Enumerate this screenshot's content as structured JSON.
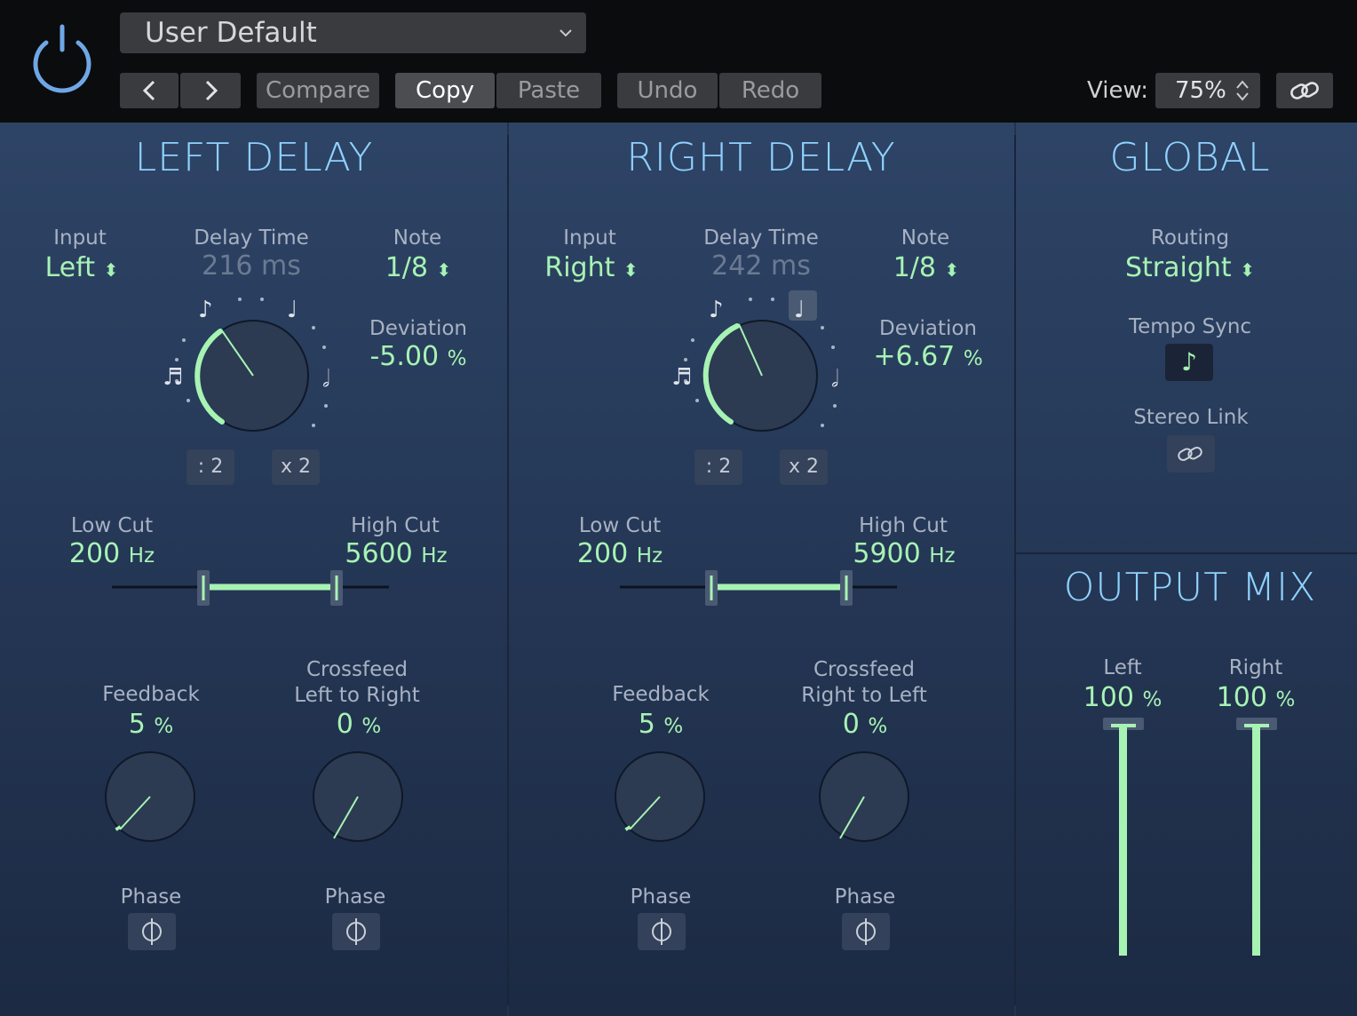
{
  "toolbar": {
    "preset": "User Default",
    "prev": "<",
    "next": ">",
    "compare": "Compare",
    "copy": "Copy",
    "paste": "Paste",
    "undo": "Undo",
    "redo": "Redo",
    "view_label": "View:",
    "view_value": "75%",
    "icons": [
      "power-icon",
      "chevron-down-icon",
      "link-icon",
      "stepper-icon"
    ]
  },
  "left_delay": {
    "title": "LEFT DELAY",
    "input_label": "Input",
    "input_value": "Left",
    "delay_time_label": "Delay Time",
    "delay_time_value": "216 ms",
    "note_label": "Note",
    "note_value": "1/8",
    "deviation_label": "Deviation",
    "deviation_value": "-5.00",
    "deviation_unit": "%",
    "half_label": ": 2",
    "double_label": "x 2",
    "low_cut_label": "Low Cut",
    "low_cut_value": "200",
    "high_cut_label": "High Cut",
    "high_cut_value": "5600",
    "hz": "Hz",
    "feedback_label": "Feedback",
    "feedback_value": "5",
    "crossfeed_label_1": "Crossfeed",
    "crossfeed_label_2": "Left to Right",
    "crossfeed_value": "0",
    "pct": "%",
    "phase_label": "Phase"
  },
  "right_delay": {
    "title": "RIGHT DELAY",
    "input_label": "Input",
    "input_value": "Right",
    "delay_time_label": "Delay Time",
    "delay_time_value": "242 ms",
    "note_label": "Note",
    "note_value": "1/8",
    "deviation_label": "Deviation",
    "deviation_value": "+6.67",
    "deviation_unit": "%",
    "half_label": ": 2",
    "double_label": "x 2",
    "low_cut_label": "Low Cut",
    "low_cut_value": "200",
    "high_cut_label": "High Cut",
    "high_cut_value": "5900",
    "hz": "Hz",
    "feedback_label": "Feedback",
    "feedback_value": "5",
    "crossfeed_label_1": "Crossfeed",
    "crossfeed_label_2": "Right to Left",
    "crossfeed_value": "0",
    "pct": "%",
    "phase_label": "Phase"
  },
  "global": {
    "title": "GLOBAL",
    "routing_label": "Routing",
    "routing_value": "Straight",
    "tempo_sync_label": "Tempo Sync",
    "tempo_sync_on": true,
    "stereo_link_label": "Stereo Link",
    "stereo_link_on": false
  },
  "output_mix": {
    "title": "OUTPUT MIX",
    "left_label": "Left",
    "left_value": "100",
    "right_label": "Right",
    "right_value": "100",
    "pct": "%"
  },
  "colors": {
    "accent_green": "#a7f3b3",
    "title_blue": "#8fd2ff",
    "power_blue": "#6fa7e6"
  }
}
